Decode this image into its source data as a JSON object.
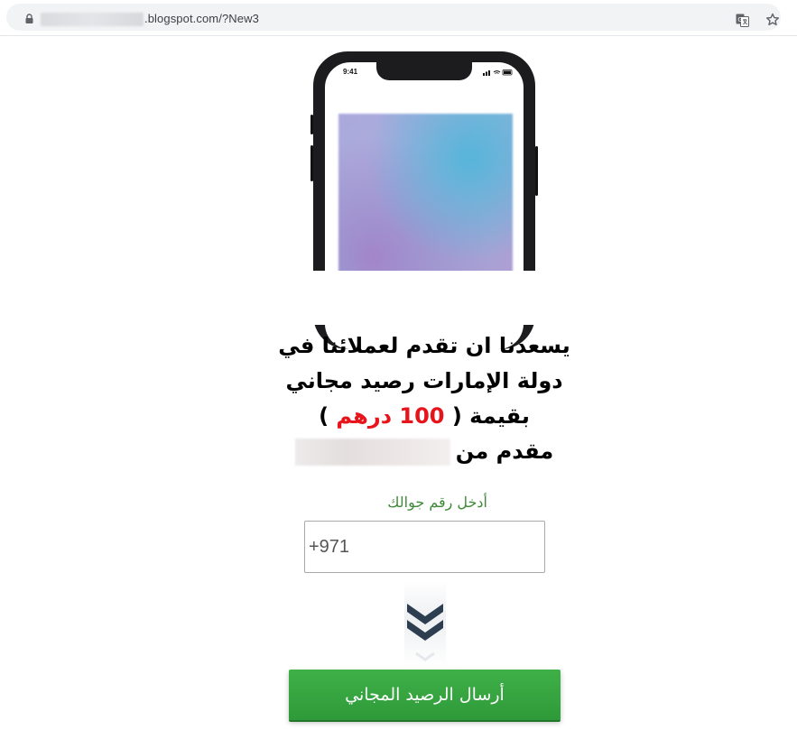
{
  "browser": {
    "url_text": ".blogspot.com/?New3",
    "lock_icon": "lock-icon",
    "translate_icon": "translate-icon",
    "bookmark_icon": "star-icon"
  },
  "phone": {
    "status_time": "9:41"
  },
  "headline": {
    "line1": "يسعدنا ان تقدم لعملائنا في",
    "line2": "دولة الإمارات رصيد مجاني",
    "line3_prefix": "بقيمة (",
    "line3_amount": "100 درهم",
    "line3_suffix": ")",
    "line4": "مقدم من"
  },
  "form": {
    "label": "أدخل رقم جوالك",
    "phone_value": "+971",
    "submit_label": "أرسال الرصيد المجاني"
  },
  "colors": {
    "accent_red": "#e8141c",
    "label_green": "#3f8a38",
    "button_green": "#34a340",
    "chevron_navy": "#2c3e50"
  }
}
